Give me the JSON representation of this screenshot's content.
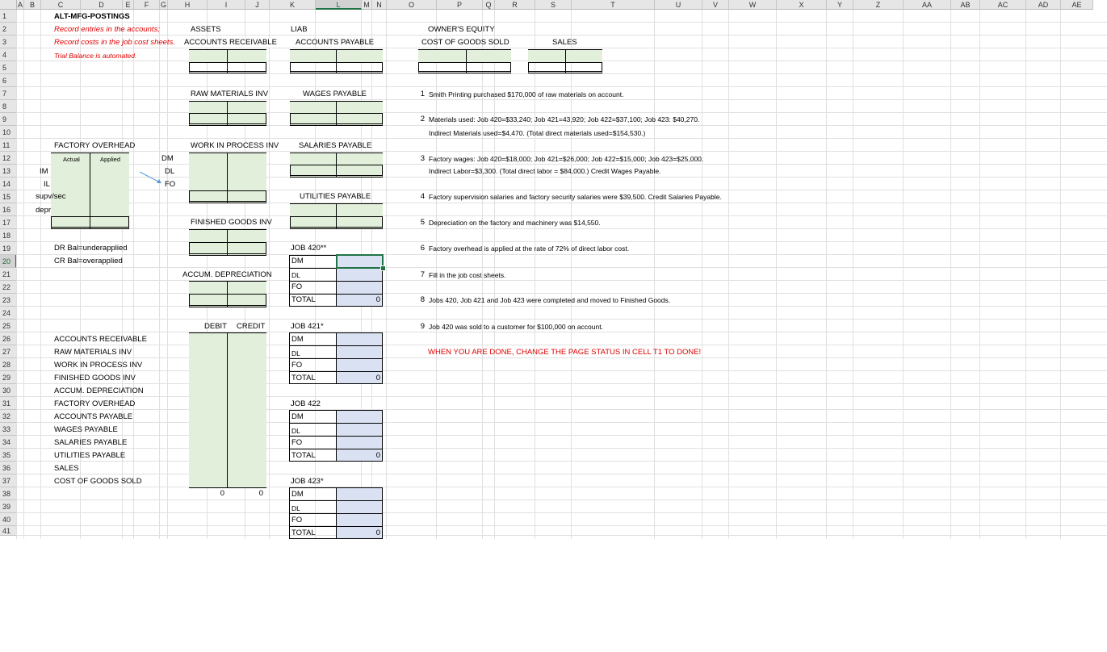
{
  "columns": [
    "A",
    "B",
    "C",
    "D",
    "E",
    "F",
    "G",
    "H",
    "I",
    "J",
    "K",
    "L",
    "M",
    "N",
    "O",
    "P",
    "Q",
    "R",
    "S",
    "T",
    "U",
    "V",
    "W",
    "X",
    "Y",
    "Z",
    "AA",
    "AB",
    "AC",
    "AD",
    "AE"
  ],
  "rows": [
    "1",
    "2",
    "3",
    "4",
    "5",
    "6",
    "7",
    "8",
    "9",
    "10",
    "11",
    "12",
    "13",
    "14",
    "15",
    "16",
    "17",
    "18",
    "19",
    "20",
    "21",
    "22",
    "23",
    "24",
    "25",
    "26",
    "27",
    "28",
    "29",
    "30",
    "31",
    "32",
    "33",
    "34",
    "35",
    "36",
    "37",
    "38",
    "39",
    "40",
    "41"
  ],
  "header": {
    "title": "ALT-MFG-POSTINGS",
    "instr1": "Record entries in the accounts;",
    "instr2": "Record costs in the job cost sheets.",
    "instr3": "Trial Balance is automated.",
    "assets": "ASSETS",
    "liab": "LIAB",
    "owners_equity": "OWNER'S EQUITY"
  },
  "taccounts": {
    "accounts_receivable": "ACCOUNTS RECEIVABLE",
    "accounts_payable": "ACCOUNTS PAYABLE",
    "cogs": "COST OF GOODS SOLD",
    "sales": "SALES",
    "raw_materials": "RAW MATERIALS INV",
    "wages_payable": "WAGES PAYABLE",
    "wip": "WORK IN PROCESS INV",
    "salaries_payable": "SALARIES PAYABLE",
    "utilities_payable": "UTILITIES PAYABLE",
    "finished_goods": "FINISHED GOODS INV",
    "accum_depr": "ACCUM. DEPRECIATION"
  },
  "overhead": {
    "title": "FACTORY OVERHEAD",
    "actual": "Actual",
    "applied": "Applied",
    "im": "IM",
    "il": "IL",
    "supv": "supv/sec",
    "depr": "depr",
    "dm": "DM",
    "dl": "DL",
    "fo": "FO",
    "dr_note": "DR Bal=underapplied",
    "cr_note": "CR Bal=overapplied"
  },
  "trial_balance": {
    "debit": "DEBIT",
    "credit": "CREDIT",
    "accounts": [
      "ACCOUNTS RECEIVABLE",
      "RAW MATERIALS INV",
      "WORK IN PROCESS INV",
      "FINISHED GOODS INV",
      "ACCUM. DEPRECIATION",
      "FACTORY OVERHEAD",
      "ACCOUNTS PAYABLE",
      "WAGES PAYABLE",
      "SALARIES PAYABLE",
      "UTILITIES PAYABLE",
      "SALES",
      "COST OF GOODS SOLD"
    ],
    "debit_total": "0",
    "credit_total": "0"
  },
  "jobs": [
    {
      "title": "JOB 420**",
      "dm": "DM",
      "dl": "DL",
      "fo": "FO",
      "total": "TOTAL",
      "total_value": "0"
    },
    {
      "title": "JOB 421*",
      "dm": "DM",
      "dl": "DL",
      "fo": "FO",
      "total": "TOTAL",
      "total_value": "0"
    },
    {
      "title": "JOB 422",
      "dm": "DM",
      "dl": "DL",
      "fo": "FO",
      "total": "TOTAL",
      "total_value": "0"
    },
    {
      "title": "JOB 423*",
      "dm": "DM",
      "dl": "DL",
      "fo": "FO",
      "total": "TOTAL",
      "total_value": "0"
    }
  ],
  "transactions": [
    {
      "n": "1",
      "text": "Smith Printing purchased $170,000 of raw materials on account."
    },
    {
      "n": "2",
      "text": "Materials used:  Job 420=$33,240; Job 421=43,920; Job 422=$37,100; Job 423: $40,270."
    },
    {
      "n": "",
      "text": "Indirect Materials used=$4,470.  (Total direct materials used=$154,530.)"
    },
    {
      "n": "3",
      "text": "Factory wages:  Job 420=$18,000; Job 421=$26,000; Job 422=$15,000; Job 423=$25,000."
    },
    {
      "n": "",
      "text": "Indirect Labor=$3,300.  (Total direct labor = $84,000.)  Credit Wages Payable."
    },
    {
      "n": "4",
      "text": "Factory supervision salaries and factory security salaries were $39,500.  Credit Salaries Payable."
    },
    {
      "n": "5",
      "text": "Depreciation on the factory and machinery was $14,550."
    },
    {
      "n": "6",
      "text": "Factory overhead is applied at the rate of 72% of direct labor cost."
    },
    {
      "n": "7",
      "text": "Fill in the job cost sheets."
    },
    {
      "n": "8",
      "text": "Jobs 420, Job 421 and Job 423 were completed and moved to Finished Goods."
    },
    {
      "n": "9",
      "text": "Job 420 was sold to a customer for $100,000 on account."
    }
  ],
  "done_note": "WHEN YOU ARE DONE, CHANGE THE PAGE STATUS IN CELL T1 TO DONE!",
  "colors": {
    "green": "#e2efda",
    "blue": "#d9e1f2",
    "red": "#e00000",
    "excel_green": "#217346"
  }
}
